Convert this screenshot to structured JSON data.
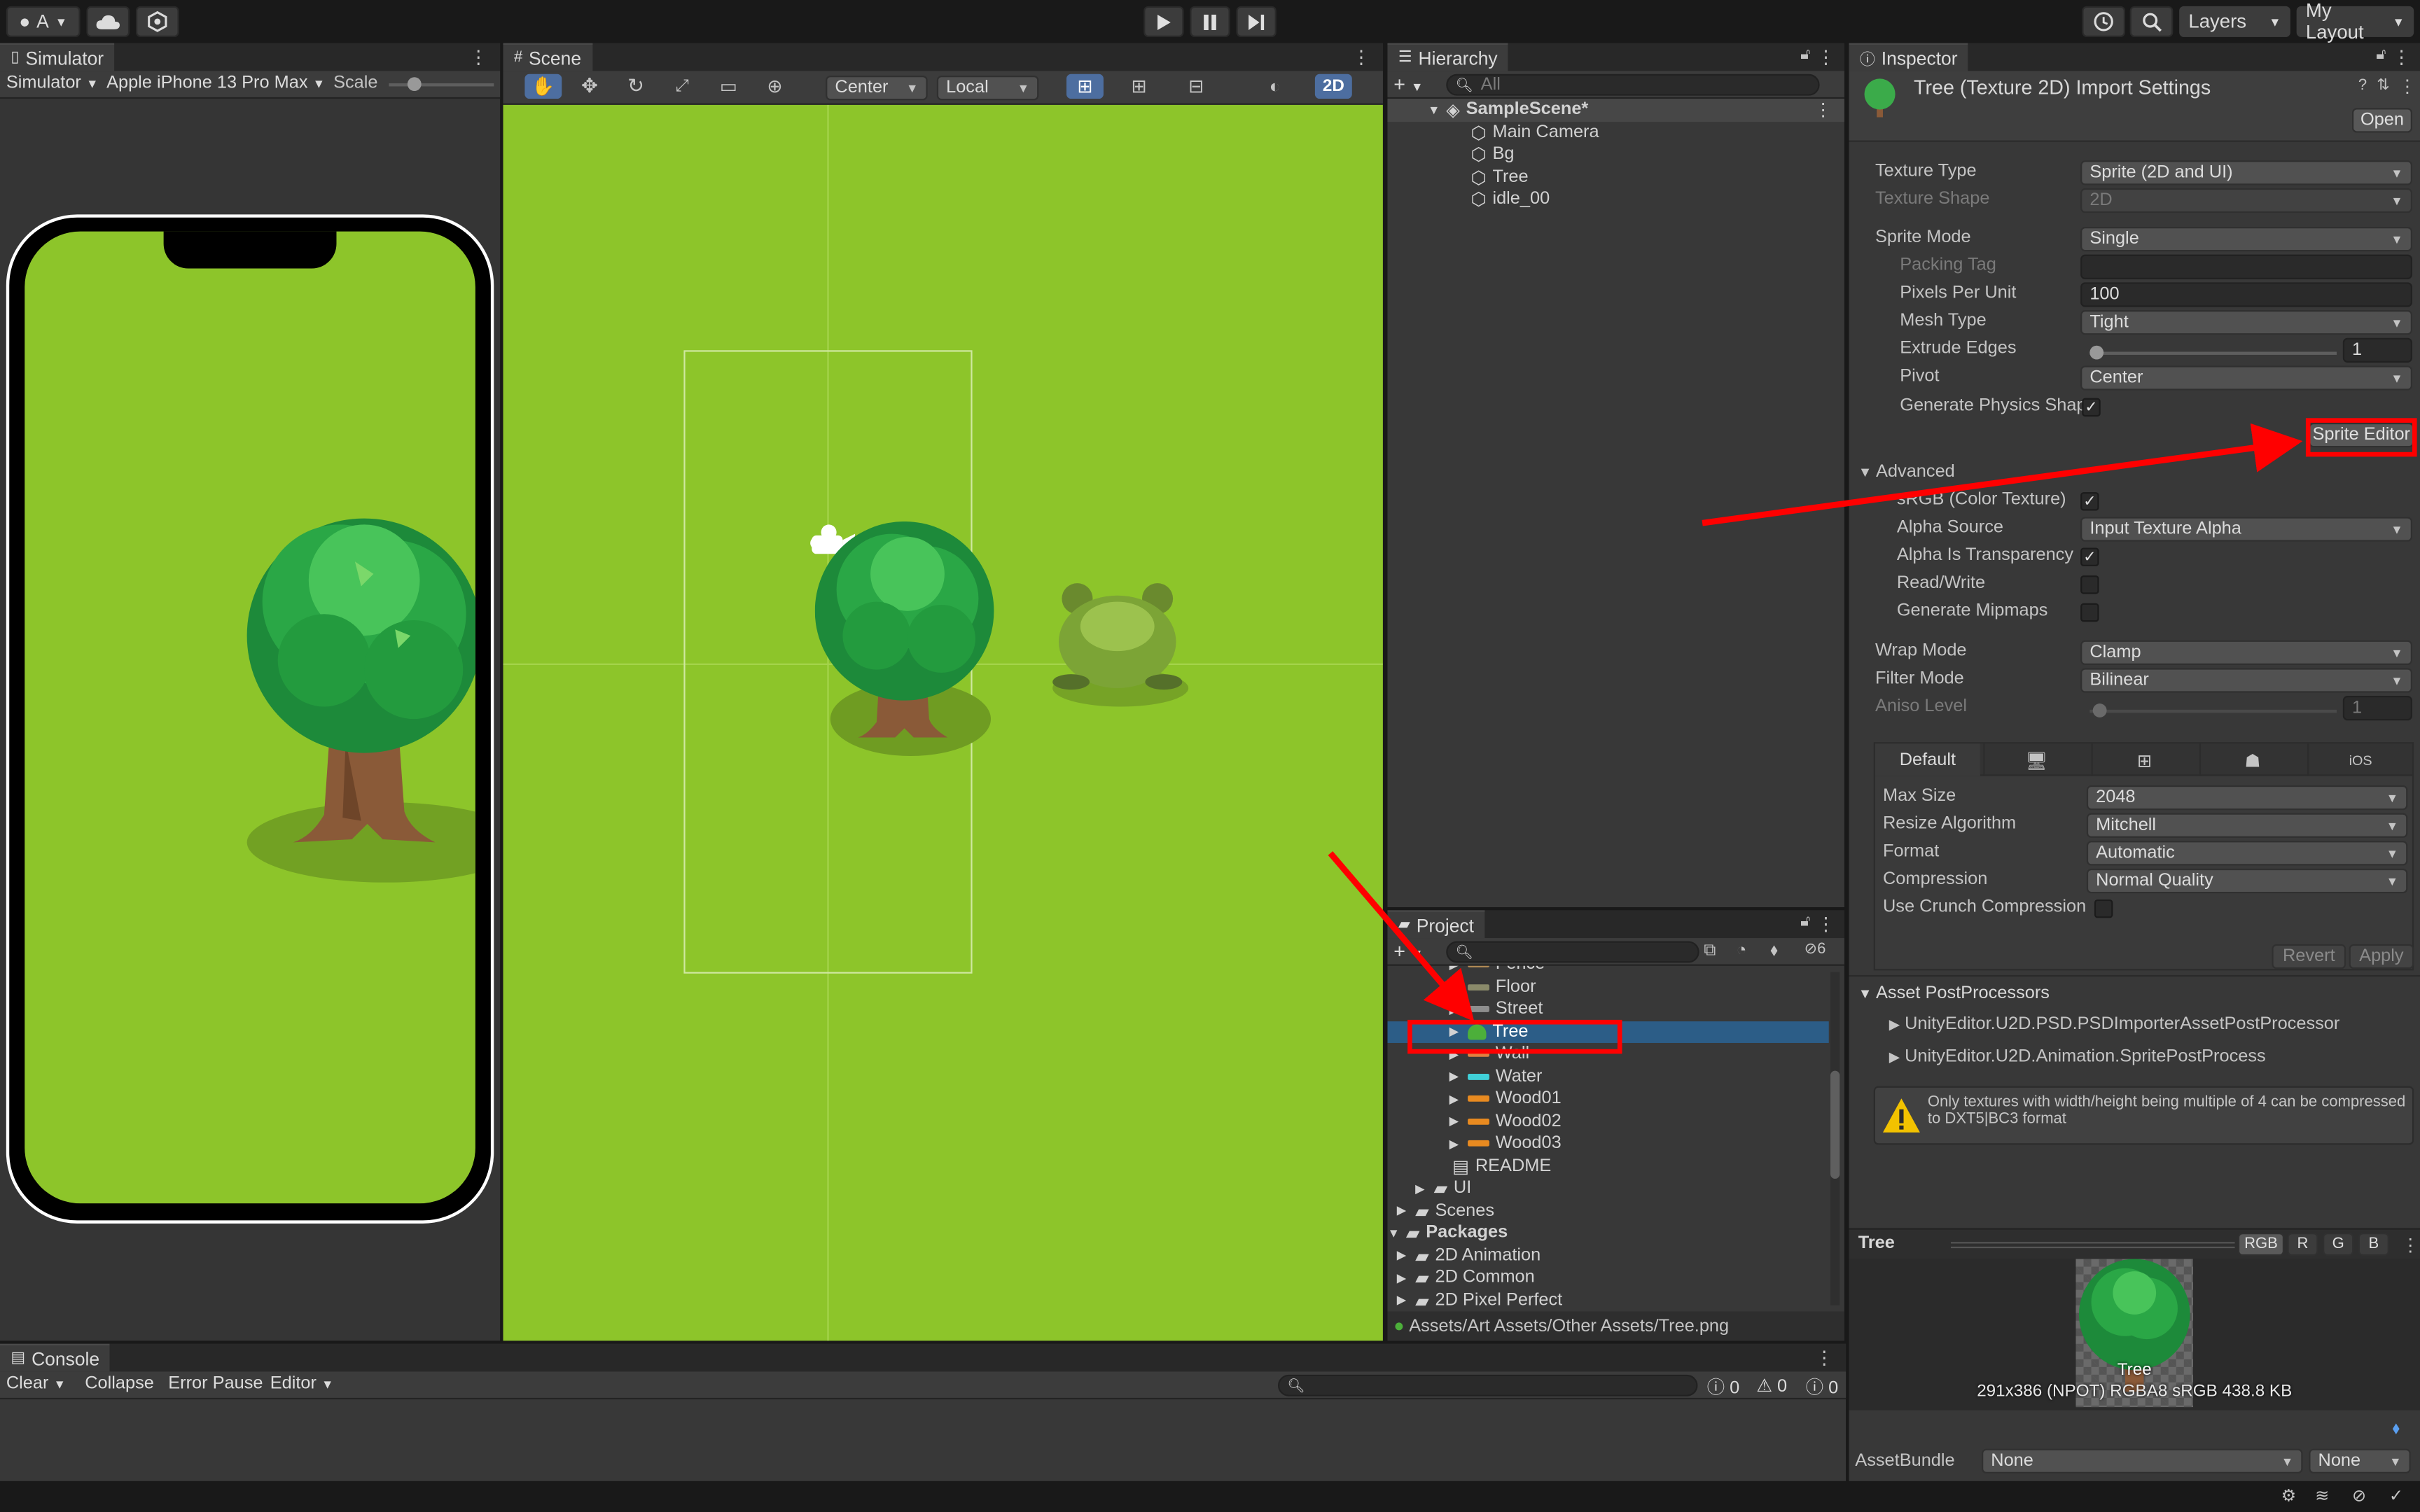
{
  "topbar": {
    "account": "A",
    "layers": "Layers",
    "layout": "My Layout"
  },
  "simulator": {
    "tab": "Simulator",
    "mode": "Simulator",
    "device": "Apple iPhone 13 Pro Max",
    "scale_label": "Scale"
  },
  "scene": {
    "tab": "Scene",
    "pivot": "Center",
    "space": "Local",
    "mode_2d": "2D"
  },
  "hierarchy": {
    "tab": "Hierarchy",
    "search_placeholder": "All",
    "scene_name": "SampleScene*",
    "items": [
      {
        "label": "Main Camera"
      },
      {
        "label": "Bg"
      },
      {
        "label": "Tree"
      },
      {
        "label": "idle_00"
      }
    ]
  },
  "project": {
    "tab": "Project",
    "hidden_count": "6",
    "items": [
      {
        "label": "Fence",
        "color": "#b08a55"
      },
      {
        "label": "Floor",
        "color": "#8a8a6a"
      },
      {
        "label": "Street",
        "color": "#8e8e8e"
      },
      {
        "label": "Tree",
        "color": "#4caf3a"
      },
      {
        "label": "Wall",
        "color": "#e08040"
      },
      {
        "label": "Water",
        "color": "#40d0d8"
      },
      {
        "label": "Wood01",
        "color": "#e88a20"
      },
      {
        "label": "Wood02",
        "color": "#e88a20"
      },
      {
        "label": "Wood03",
        "color": "#e88a20"
      },
      {
        "label": "README",
        "color": "#cccccc"
      },
      {
        "label": "UI",
        "color": "#c4c4c4"
      },
      {
        "label": "Scenes",
        "color": "#c4c4c4"
      },
      {
        "label": "Packages",
        "color": "#c4c4c4"
      },
      {
        "label": "2D Animation",
        "color": "#c4c4c4"
      },
      {
        "label": "2D Common",
        "color": "#c4c4c4"
      },
      {
        "label": "2D Pixel Perfect",
        "color": "#c4c4c4"
      }
    ],
    "path": "Assets/Art Assets/Other Assets/Tree.png"
  },
  "inspector": {
    "tab": "Inspector",
    "title": "Tree (Texture 2D) Import Settings",
    "open_btn": "Open",
    "texture_type_label": "Texture Type",
    "texture_type": "Sprite (2D and UI)",
    "texture_shape_label": "Texture Shape",
    "texture_shape": "2D",
    "sprite_mode_label": "Sprite Mode",
    "sprite_mode": "Single",
    "packing_tag_label": "Packing Tag",
    "ppu_label": "Pixels Per Unit",
    "ppu": "100",
    "mesh_type_label": "Mesh Type",
    "mesh_type": "Tight",
    "extrude_label": "Extrude Edges",
    "extrude": "1",
    "pivot_label": "Pivot",
    "pivot": "Center",
    "gen_physics_label": "Generate Physics Shap",
    "sprite_editor_btn": "Sprite Editor",
    "advanced_label": "Advanced",
    "srgb_label": "sRGB (Color Texture)",
    "alpha_source_label": "Alpha Source",
    "alpha_source": "Input Texture Alpha",
    "alpha_transp_label": "Alpha Is Transparency",
    "readwrite_label": "Read/Write",
    "mipmaps_label": "Generate Mipmaps",
    "wrap_label": "Wrap Mode",
    "wrap": "Clamp",
    "filter_label": "Filter Mode",
    "filter": "Bilinear",
    "aniso_label": "Aniso Level",
    "aniso": "1",
    "platform_default": "Default",
    "platform_ios": "iOS",
    "max_size_label": "Max Size",
    "max_size": "2048",
    "resize_label": "Resize Algorithm",
    "resize": "Mitchell",
    "format_label": "Format",
    "format": "Automatic",
    "compression_label": "Compression",
    "compression": "Normal Quality",
    "crunch_label": "Use Crunch Compression",
    "revert_btn": "Revert",
    "apply_btn": "Apply",
    "postproc_label": "Asset PostProcessors",
    "postproc_1": "UnityEditor.U2D.PSD.PSDImporterAssetPostProcessor",
    "postproc_2": "UnityEditor.U2D.Animation.SpritePostProcess",
    "warning": "Only textures with width/height being multiple of 4 can be compressed to DXT5|BC3 format",
    "preview_title": "Tree",
    "channel_rgb": "RGB",
    "channel_r": "R",
    "channel_g": "G",
    "channel_b": "B",
    "preview_name": "Tree",
    "preview_info": "291x386 (NPOT)  RGBA8 sRGB   438.8 KB",
    "assetbundle_label": "AssetBundle",
    "assetbundle": "None",
    "assetbundle_variant": "None"
  },
  "console": {
    "tab": "Console",
    "clear": "Clear",
    "collapse": "Collapse",
    "error_pause": "Error Pause",
    "editor": "Editor",
    "log_count": "0",
    "warn_count": "0",
    "error_count": "0"
  },
  "colors": {
    "scene_green": "#8dc52a",
    "selection_blue": "#2c5d87",
    "annotation_red": "#ff0000"
  }
}
